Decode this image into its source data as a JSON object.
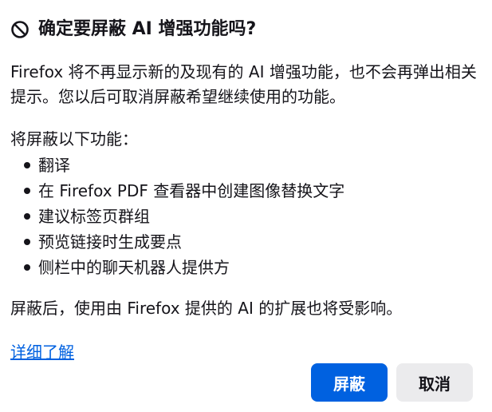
{
  "dialog": {
    "title": "确定要屏蔽 AI 增强功能吗?",
    "title_icon": "block-icon",
    "description": "Firefox 将不再显示新的及现有的 AI 增强功能，也不会再弹出相关提示。您以后可取消屏蔽希望继续使用的功能。",
    "list_heading": "将屏蔽以下功能：",
    "features": [
      "翻译",
      "在 Firefox PDF 查看器中创建图像替换文字",
      "建议标签页群组",
      "预览链接时生成要点",
      "侧栏中的聊天机器人提供方"
    ],
    "after_note": "屏蔽后，使用由 Firefox 提供的 AI 的扩展也将受影响。",
    "learn_more": "详细了解",
    "primary_button": "屏蔽",
    "secondary_button": "取消"
  },
  "colors": {
    "accent": "#0061e0",
    "text": "#15141a",
    "secondary_button_bg": "#ebebed"
  }
}
